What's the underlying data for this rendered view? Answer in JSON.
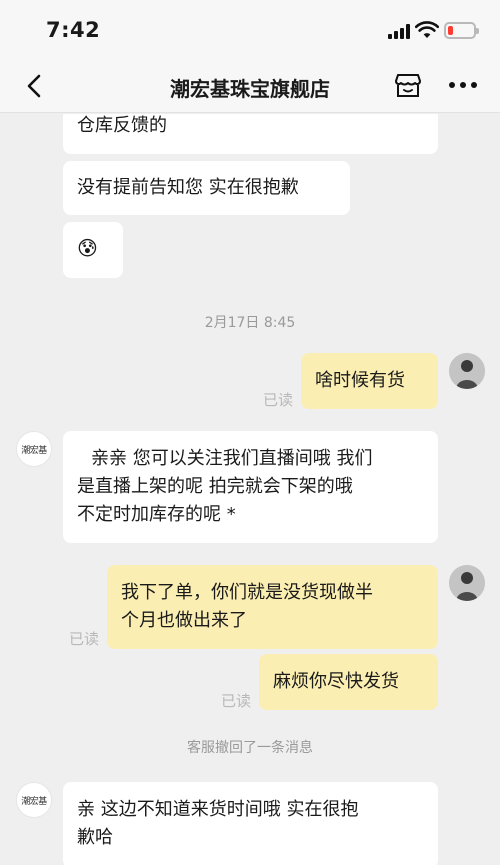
{
  "status_bar": {
    "time": "7:42"
  },
  "nav": {
    "title": "潮宏基珠宝旗舰店"
  },
  "messages": {
    "m1": "仓库反馈的",
    "m2": "没有提前告知您 实在很抱歉",
    "m3_emoji": "😰",
    "date_divider": "2月17日 8:45",
    "m4": "啥时候有货",
    "m4_read": "已读",
    "m5_line1": "亲亲 您可以关注我们直播间哦 我们",
    "m5_line2": "是直播上架的呢 拍完就会下架的哦",
    "m5_line3": "不定时加库存的呢 *",
    "m6_line1": "我下了单，你们就是没货现做半",
    "m6_line2": "个月也做出来了",
    "m6_read": "已读",
    "m7": "麻烦你尽快发货",
    "m7_read": "已读",
    "recall_notice": "客服撤回了一条消息",
    "m8_line1": "亲 这边不知道来货时间哦 实在很抱",
    "m8_line2": "歉哈"
  },
  "shop_avatar_text": "潮宏基",
  "colors": {
    "self_bubble": "#fbeeb2",
    "other_bubble": "#ffffff",
    "background": "#efefef",
    "battery_low": "#ff3b30"
  }
}
